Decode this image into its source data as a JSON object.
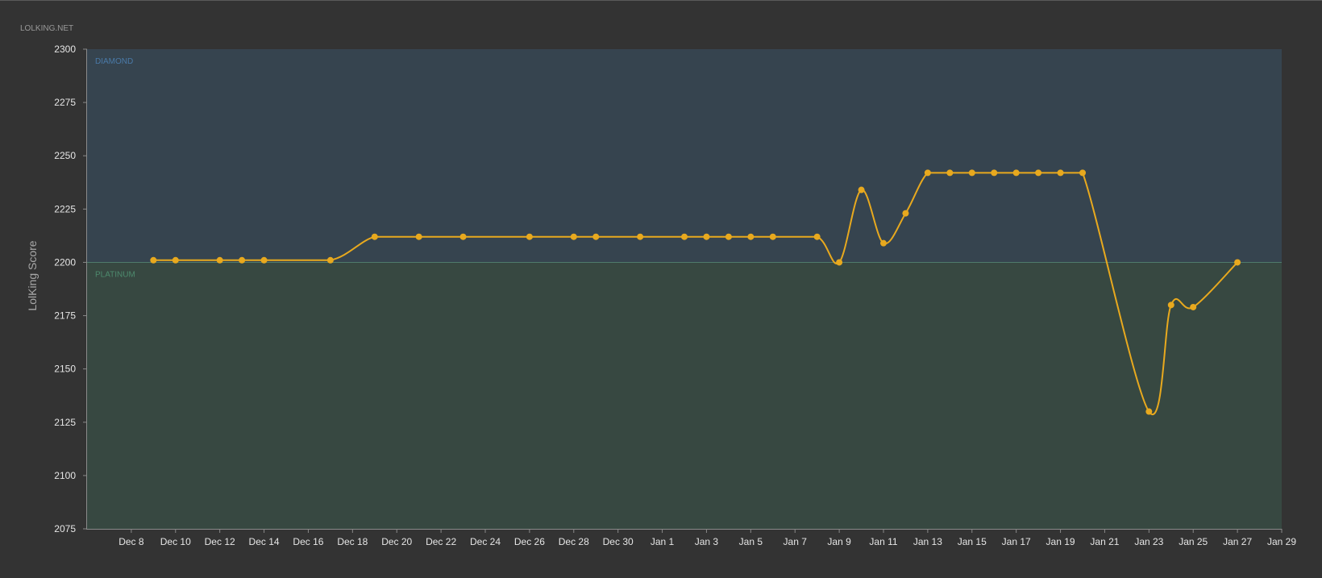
{
  "site_label": "LOLKING.NET",
  "colors": {
    "background": "#333333",
    "diamond_band": "#36444f",
    "platinum_band": "#374841",
    "diamond_label": "#4a7aa8",
    "platinum_label": "#4d8a6d",
    "line": "#e8a91e",
    "axis": "#8a8a8a"
  },
  "chart_data": {
    "type": "line",
    "title": "",
    "xlabel": "",
    "ylabel": "LolKing Score",
    "ylim": [
      2075,
      2300
    ],
    "y_ticks": [
      2075,
      2100,
      2125,
      2150,
      2175,
      2200,
      2225,
      2250,
      2275,
      2300
    ],
    "x_range": [
      "2013-12-06",
      "2014-01-29"
    ],
    "x_ticks": [
      {
        "date": "2013-12-08",
        "label": "Dec 8"
      },
      {
        "date": "2013-12-10",
        "label": "Dec 10"
      },
      {
        "date": "2013-12-12",
        "label": "Dec 12"
      },
      {
        "date": "2013-12-14",
        "label": "Dec 14"
      },
      {
        "date": "2013-12-16",
        "label": "Dec 16"
      },
      {
        "date": "2013-12-18",
        "label": "Dec 18"
      },
      {
        "date": "2013-12-20",
        "label": "Dec 20"
      },
      {
        "date": "2013-12-22",
        "label": "Dec 22"
      },
      {
        "date": "2013-12-24",
        "label": "Dec 24"
      },
      {
        "date": "2013-12-26",
        "label": "Dec 26"
      },
      {
        "date": "2013-12-28",
        "label": "Dec 28"
      },
      {
        "date": "2013-12-30",
        "label": "Dec 30"
      },
      {
        "date": "2014-01-01",
        "label": "Jan 1"
      },
      {
        "date": "2014-01-03",
        "label": "Jan 3"
      },
      {
        "date": "2014-01-05",
        "label": "Jan 5"
      },
      {
        "date": "2014-01-07",
        "label": "Jan 7"
      },
      {
        "date": "2014-01-09",
        "label": "Jan 9"
      },
      {
        "date": "2014-01-11",
        "label": "Jan 11"
      },
      {
        "date": "2014-01-13",
        "label": "Jan 13"
      },
      {
        "date": "2014-01-15",
        "label": "Jan 15"
      },
      {
        "date": "2014-01-17",
        "label": "Jan 17"
      },
      {
        "date": "2014-01-19",
        "label": "Jan 19"
      },
      {
        "date": "2014-01-21",
        "label": "Jan 21"
      },
      {
        "date": "2014-01-23",
        "label": "Jan 23"
      },
      {
        "date": "2014-01-25",
        "label": "Jan 25"
      },
      {
        "date": "2014-01-27",
        "label": "Jan 27"
      },
      {
        "date": "2014-01-29",
        "label": "Jan 29"
      }
    ],
    "bands": [
      {
        "label": "DIAMOND",
        "from": 2200,
        "to": 2300
      },
      {
        "label": "PLATINUM",
        "from": 2075,
        "to": 2200
      }
    ],
    "series": [
      {
        "points": [
          {
            "x": "2013-12-09",
            "y": 2201
          },
          {
            "x": "2013-12-10",
            "y": 2201
          },
          {
            "x": "2013-12-12",
            "y": 2201
          },
          {
            "x": "2013-12-13",
            "y": 2201
          },
          {
            "x": "2013-12-14",
            "y": 2201
          },
          {
            "x": "2013-12-17",
            "y": 2201
          },
          {
            "x": "2013-12-19",
            "y": 2212
          },
          {
            "x": "2013-12-21",
            "y": 2212
          },
          {
            "x": "2013-12-23",
            "y": 2212
          },
          {
            "x": "2013-12-26",
            "y": 2212
          },
          {
            "x": "2013-12-28",
            "y": 2212
          },
          {
            "x": "2013-12-29",
            "y": 2212
          },
          {
            "x": "2013-12-31",
            "y": 2212
          },
          {
            "x": "2014-01-02",
            "y": 2212
          },
          {
            "x": "2014-01-03",
            "y": 2212
          },
          {
            "x": "2014-01-04",
            "y": 2212
          },
          {
            "x": "2014-01-05",
            "y": 2212
          },
          {
            "x": "2014-01-06",
            "y": 2212
          },
          {
            "x": "2014-01-08",
            "y": 2212
          },
          {
            "x": "2014-01-09",
            "y": 2200
          },
          {
            "x": "2014-01-10",
            "y": 2234
          },
          {
            "x": "2014-01-11",
            "y": 2209
          },
          {
            "x": "2014-01-12",
            "y": 2223
          },
          {
            "x": "2014-01-13",
            "y": 2242
          },
          {
            "x": "2014-01-14",
            "y": 2242
          },
          {
            "x": "2014-01-15",
            "y": 2242
          },
          {
            "x": "2014-01-16",
            "y": 2242
          },
          {
            "x": "2014-01-17",
            "y": 2242
          },
          {
            "x": "2014-01-18",
            "y": 2242
          },
          {
            "x": "2014-01-19",
            "y": 2242
          },
          {
            "x": "2014-01-20",
            "y": 2242
          },
          {
            "x": "2014-01-23",
            "y": 2130
          },
          {
            "x": "2014-01-24",
            "y": 2180
          },
          {
            "x": "2014-01-25",
            "y": 2179
          },
          {
            "x": "2014-01-27",
            "y": 2200
          }
        ]
      }
    ],
    "grid": false,
    "legend": "none"
  }
}
